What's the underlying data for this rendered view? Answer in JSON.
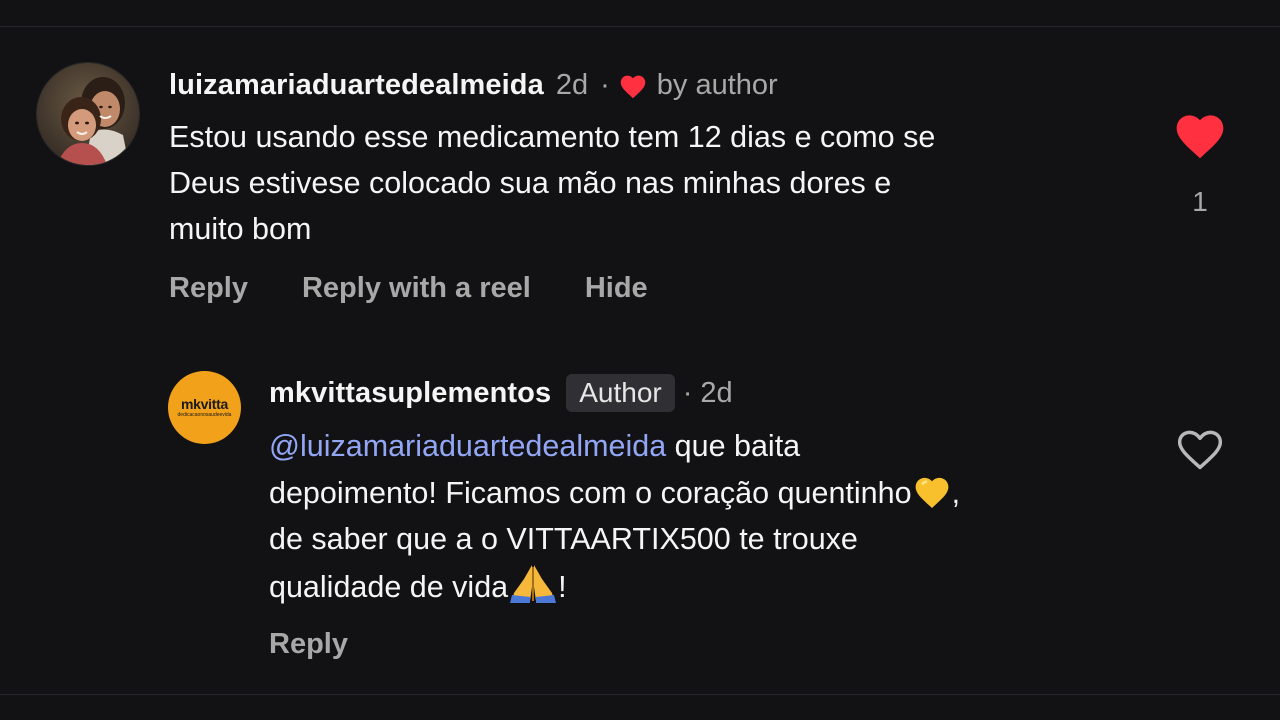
{
  "comment": {
    "username": "luizamariaduartedealmeida",
    "time": "2d",
    "separator": "·",
    "liked_by_author": "by author",
    "text_lines": [
      "Estou usando esse medicamento tem 12 dias e como se",
      "Deus estivese colocado sua mão nas minhas dores e",
      "muito bom"
    ],
    "actions": {
      "reply": "Reply",
      "reply_reel": "Reply with a reel",
      "hide": "Hide"
    },
    "like_count": "1",
    "liked": true,
    "heart_color": "#ff3040"
  },
  "reply": {
    "username": "mkvittasuplementos",
    "badge": "Author",
    "separator": "·",
    "time": "2d",
    "avatar": {
      "brand": "mkvitta",
      "tagline": "dedicacaonosaudeevida",
      "color": "#f2a11a"
    },
    "mention": "@luizamariaduartedealmeida",
    "text_line1_rest": " que baita",
    "text_line2": "depoimento! Ficamos com o coração quentinho",
    "text_line2_end": ",",
    "text_line3": "de saber que a o VITTAARTIX500 te trouxe",
    "text_line4": "qualidade de vida",
    "text_line4_end": "!",
    "emojis": [
      "yellow-heart",
      "folded-hands"
    ],
    "actions": {
      "reply": "Reply"
    },
    "liked": false,
    "mention_color": "#92a6f5"
  }
}
